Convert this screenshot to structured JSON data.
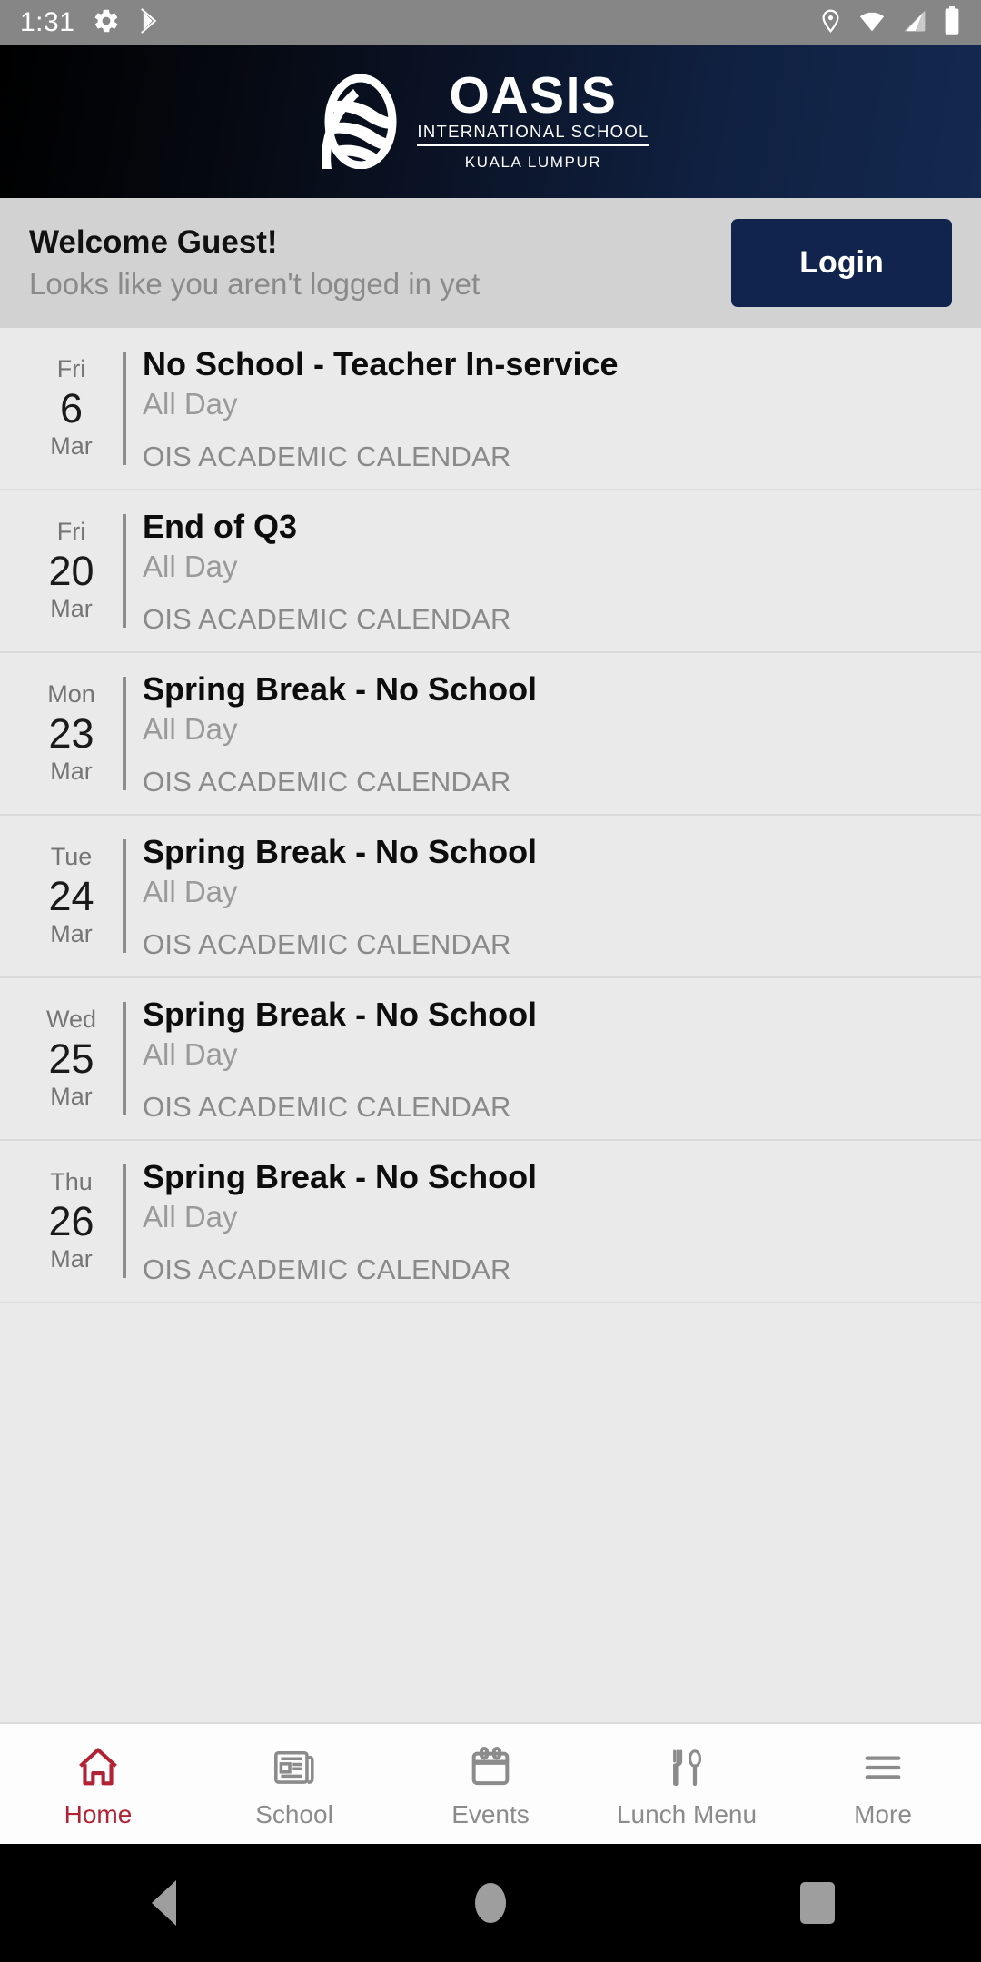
{
  "status_bar": {
    "time": "1:31",
    "left_icons": [
      "gear-icon",
      "play-store-icon"
    ],
    "right_icons": [
      "location-pin-icon",
      "wifi-icon",
      "cell-signal-icon",
      "battery-icon"
    ],
    "background_color": "#868686"
  },
  "header": {
    "logo_name": "OASIS",
    "logo_subtitle": "INTERNATIONAL SCHOOL",
    "logo_city": "KUALA LUMPUR",
    "background_color": "#0b1428",
    "logo_icon": "oasis-wave-oval-logo"
  },
  "welcome": {
    "title": "Welcome Guest!",
    "subtitle": "Looks like you aren't logged in yet",
    "login_label": "Login",
    "button_color": "#11244d",
    "background_color": "#d2d2d2"
  },
  "events": [
    {
      "dow": "Fri",
      "day": "6",
      "month": "Mar",
      "title": "No School - Teacher In-service",
      "time": "All Day",
      "calendar": "OIS ACADEMIC CALENDAR"
    },
    {
      "dow": "Fri",
      "day": "20",
      "month": "Mar",
      "title": "End of Q3",
      "time": "All Day",
      "calendar": "OIS ACADEMIC CALENDAR"
    },
    {
      "dow": "Mon",
      "day": "23",
      "month": "Mar",
      "title": "Spring Break - No School",
      "time": "All Day",
      "calendar": "OIS ACADEMIC CALENDAR"
    },
    {
      "dow": "Tue",
      "day": "24",
      "month": "Mar",
      "title": "Spring Break - No School",
      "time": "All Day",
      "calendar": "OIS ACADEMIC CALENDAR"
    },
    {
      "dow": "Wed",
      "day": "25",
      "month": "Mar",
      "title": "Spring Break - No School",
      "time": "All Day",
      "calendar": "OIS ACADEMIC CALENDAR"
    },
    {
      "dow": "Thu",
      "day": "26",
      "month": "Mar",
      "title": "Spring Break - No School",
      "time": "All Day",
      "calendar": "OIS ACADEMIC CALENDAR"
    }
  ],
  "tabbar": {
    "active_color": "#b22234",
    "inactive_color": "#8b8b8b",
    "items": [
      {
        "label": "Home",
        "icon": "home-icon",
        "active": true
      },
      {
        "label": "School",
        "icon": "newspaper-icon",
        "active": false
      },
      {
        "label": "Events",
        "icon": "calendar-icon",
        "active": false
      },
      {
        "label": "Lunch Menu",
        "icon": "cutlery-icon",
        "active": false
      },
      {
        "label": "More",
        "icon": "hamburger-icon",
        "active": false
      }
    ]
  },
  "android_nav": {
    "back": "back-triangle",
    "home": "home-circle",
    "recents": "recents-square"
  }
}
